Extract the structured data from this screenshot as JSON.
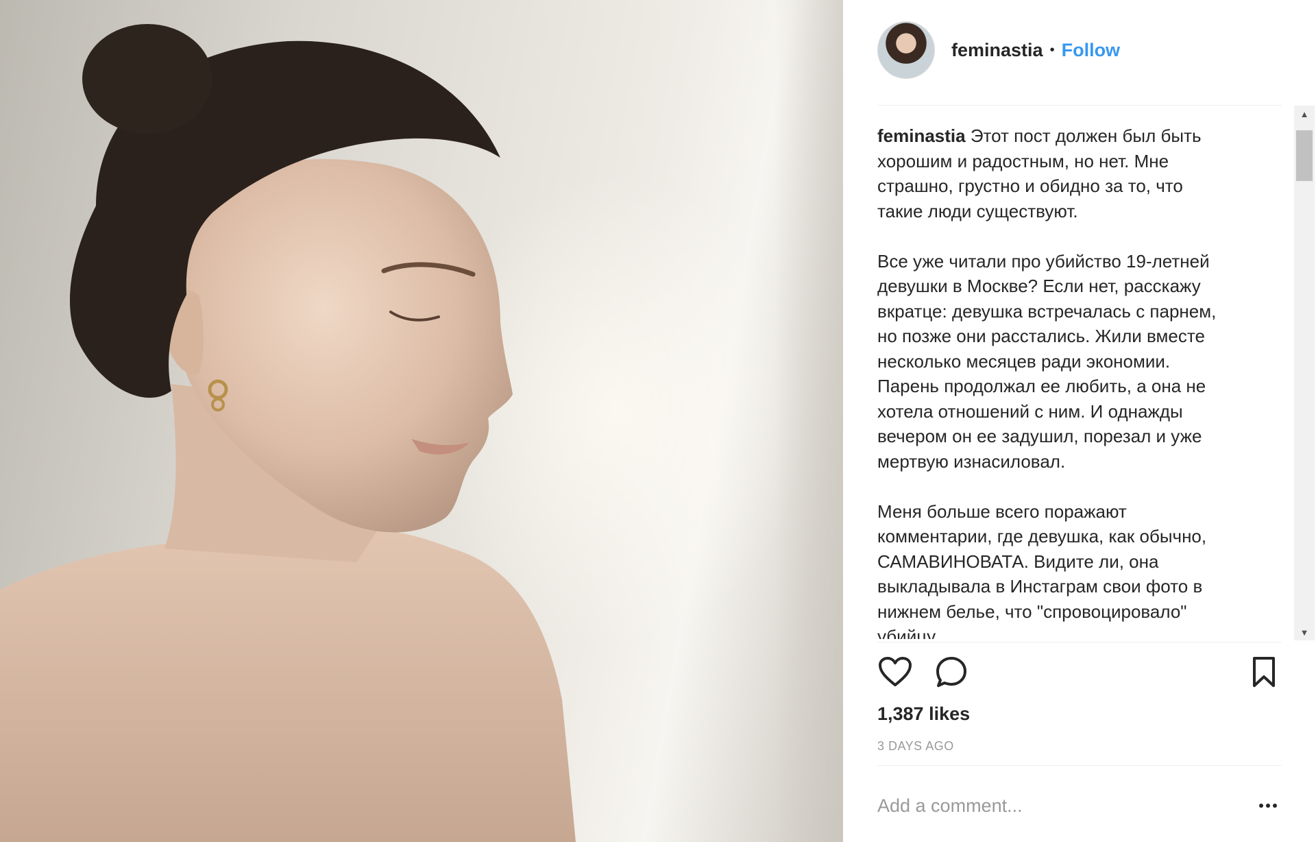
{
  "post": {
    "username": "feminastia",
    "follow_label": "Follow",
    "separator": "•",
    "caption_user": "feminastia",
    "caption_text": " Этот пост должен был быть\nхорошим и радостным, но нет. Мне\nстрашно, грустно и обидно за то, что\nтакие люди существуют.\n\nВсе уже читали про убийство 19-летней\nдевушки в Москве? Если нет, расскажу\nвкратце: девушка встречалась с парнем,\nно позже они расстались. Жили вместе\nнесколько месяцев ради экономии.\nПарень продолжал ее любить, а она не\nхотела отношений с ним. И однажды\nвечером он ее задушил, порезал и уже\nмертвую изнасиловал.\n\nМеня больше всего поражают\nкомментарии, где девушка, как обычно,\nСАМАВИНОВАТА. Видите ли, она\nвыкладывала в Инстаграм свои фото в\nнижнем белье, что \"спровоцировало\"\nубийцу.",
    "likes": "1,387 likes",
    "time_ago": "3 DAYS AGO",
    "comment_placeholder": "Add a comment..."
  },
  "icons": {
    "like": "heart-icon",
    "comment": "comment-bubble-icon",
    "save": "bookmark-icon",
    "more": "more-options-icon"
  },
  "colors": {
    "link": "#3897f0",
    "text": "#262626",
    "muted": "#999999",
    "divider": "#efefef"
  }
}
